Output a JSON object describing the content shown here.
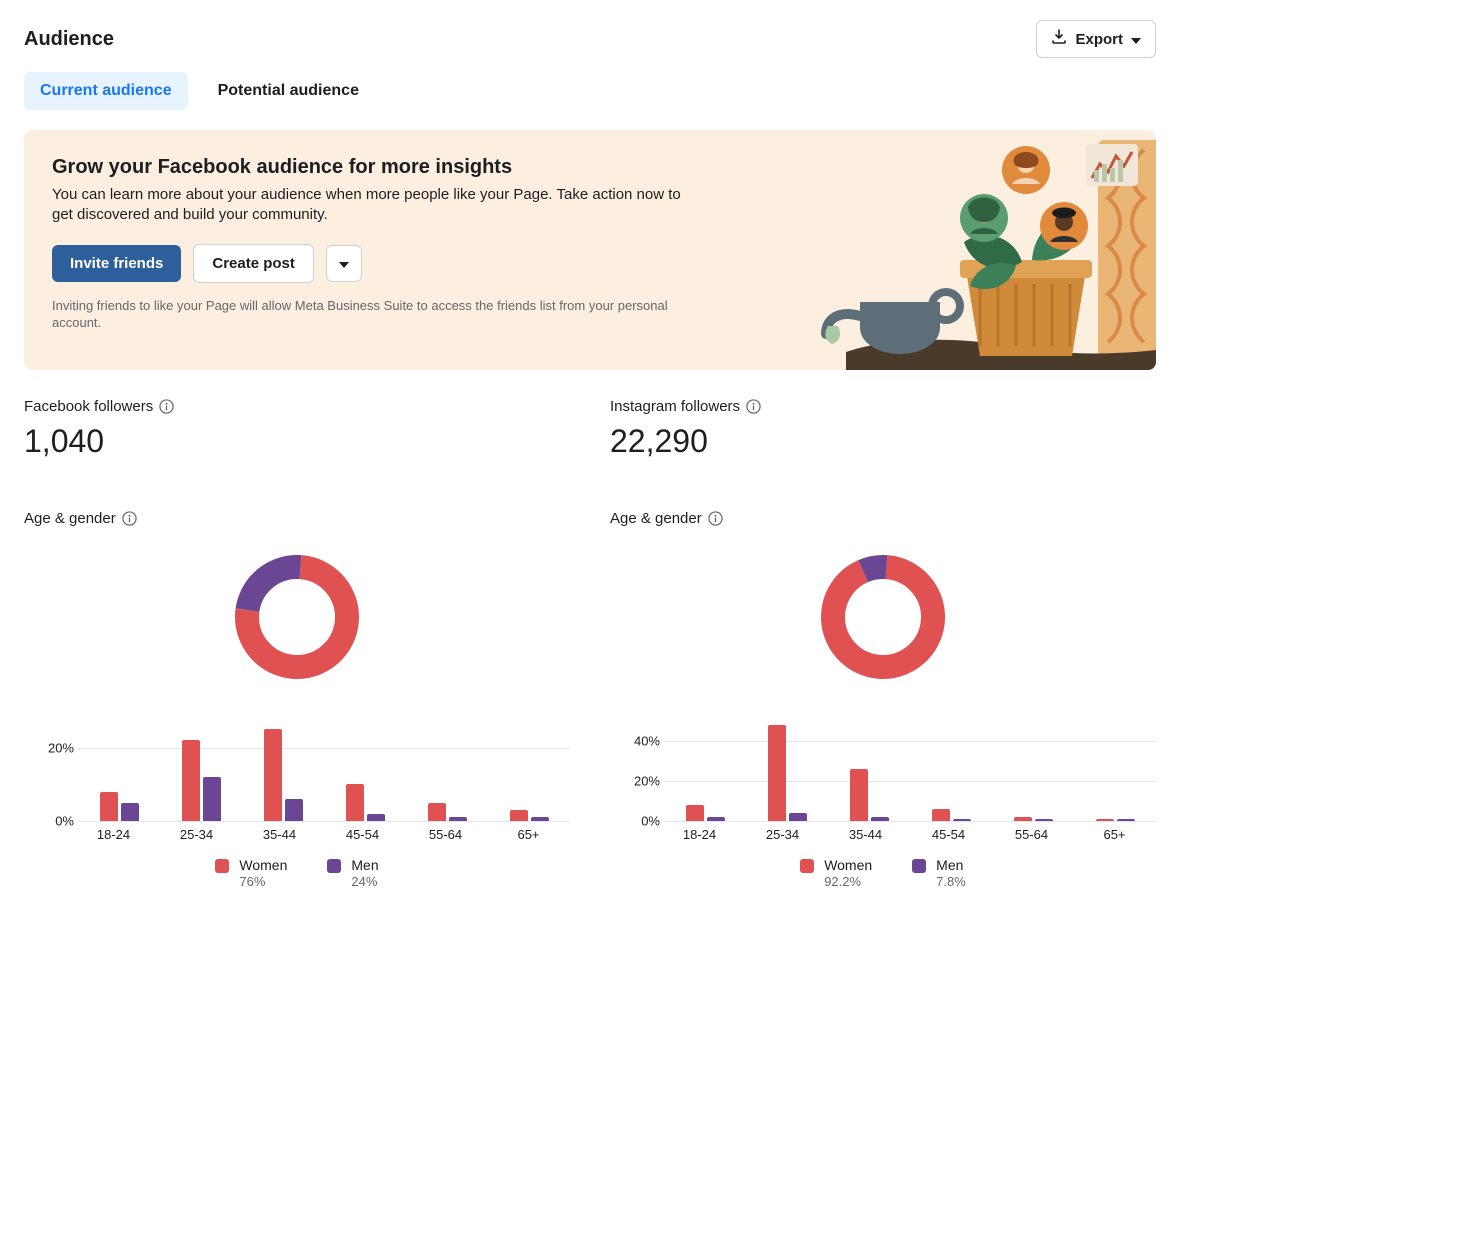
{
  "header": {
    "title": "Audience",
    "export_label": "Export"
  },
  "tabs": [
    {
      "label": "Current audience",
      "active": true
    },
    {
      "label": "Potential audience",
      "active": false
    }
  ],
  "banner": {
    "title": "Grow your Facebook audience for more insights",
    "description": "You can learn more about your audience when more people like your Page. Take action now to get discovered and build your community.",
    "primary_label": "Invite friends",
    "secondary_label": "Create post",
    "note": "Inviting friends to like your Page will allow Meta Business Suite to access the friends list from your personal account."
  },
  "stats": {
    "facebook": {
      "label": "Facebook followers",
      "value": "1,040"
    },
    "instagram": {
      "label": "Instagram followers",
      "value": "22,290"
    }
  },
  "chart_section": {
    "title": "Age & gender",
    "legend": {
      "women": "Women",
      "men": "Men"
    }
  },
  "colors": {
    "women": "#e05252",
    "men": "#6b4695",
    "banner_bg": "#fcefdf",
    "accent": "#1877f2"
  },
  "chart_data": [
    {
      "id": "facebook_age_gender",
      "type": "bar",
      "title": "Age & gender",
      "categories": [
        "18-24",
        "25-34",
        "35-44",
        "45-54",
        "55-64",
        "65+"
      ],
      "series": [
        {
          "name": "Women",
          "values": [
            8,
            22,
            25,
            10,
            5,
            3
          ]
        },
        {
          "name": "Men",
          "values": [
            5,
            12,
            6,
            2,
            1,
            1
          ]
        }
      ],
      "xlabel": "",
      "ylabel": "",
      "y_ticks": [
        "20%",
        "0%"
      ],
      "ylim": [
        0,
        30
      ],
      "donut": {
        "women": 76,
        "men": 24
      },
      "legend_pct": {
        "women": "76%",
        "men": "24%"
      }
    },
    {
      "id": "instagram_age_gender",
      "type": "bar",
      "title": "Age & gender",
      "categories": [
        "18-24",
        "25-34",
        "35-44",
        "45-54",
        "55-64",
        "65+"
      ],
      "series": [
        {
          "name": "Women",
          "values": [
            8,
            48,
            26,
            6,
            2,
            1
          ]
        },
        {
          "name": "Men",
          "values": [
            2,
            4,
            2,
            1,
            0.5,
            0.3
          ]
        }
      ],
      "xlabel": "",
      "ylabel": "",
      "y_ticks": [
        "40%",
        "20%",
        "0%"
      ],
      "ylim": [
        0,
        55
      ],
      "donut": {
        "women": 92.2,
        "men": 7.8
      },
      "legend_pct": {
        "women": "92.2%",
        "men": "7.8%"
      }
    }
  ]
}
